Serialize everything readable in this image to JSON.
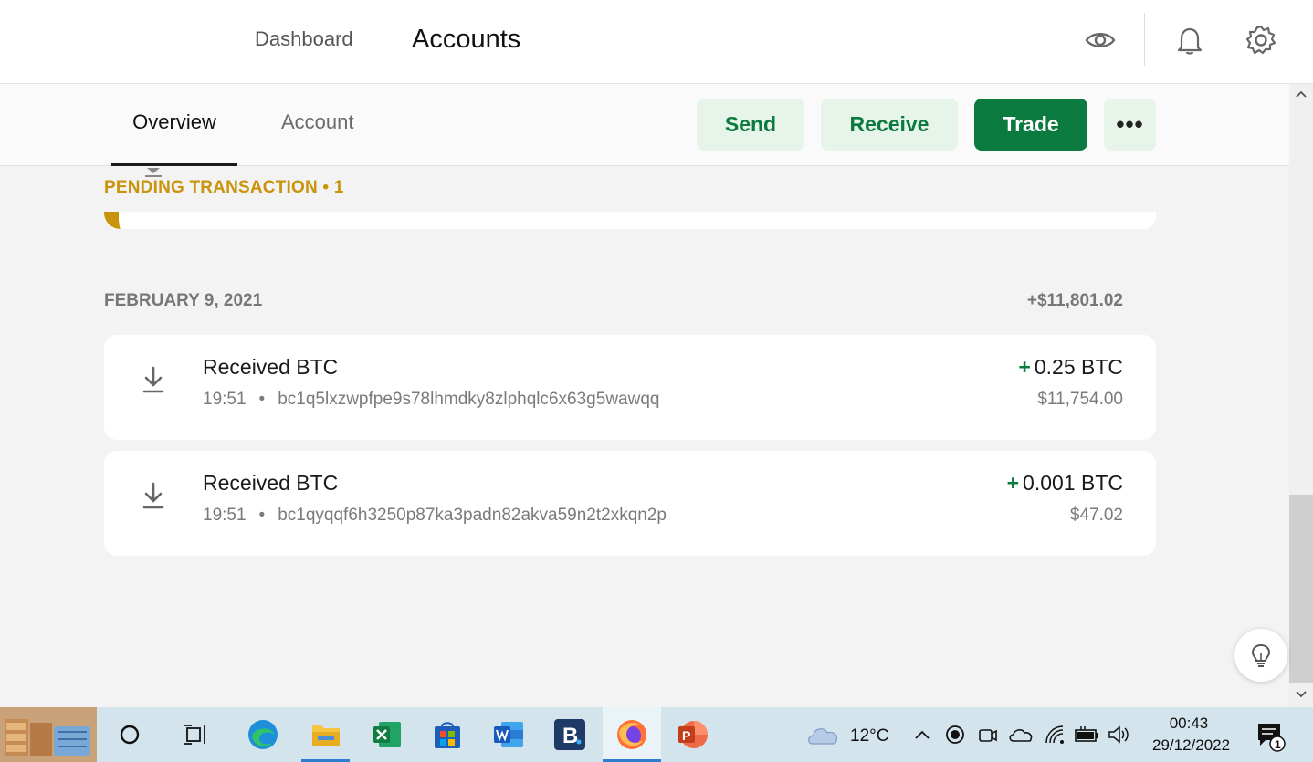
{
  "header": {
    "nav": {
      "dashboard": "Dashboard",
      "accounts": "Accounts"
    },
    "icons": [
      "eye-icon",
      "bell-icon",
      "gear-icon"
    ]
  },
  "subheader": {
    "tabs": {
      "overview": "Overview",
      "account": "Account"
    },
    "actions": {
      "send": "Send",
      "receive": "Receive",
      "trade": "Trade",
      "more": "•••"
    }
  },
  "pending": {
    "label": "PENDING TRANSACTION • 1"
  },
  "group": {
    "date": "FEBRUARY 9, 2021",
    "total": "+$11,801.02",
    "transactions": [
      {
        "title": "Received BTC",
        "time": "19:51",
        "address": "bc1q5lxzwpfpe9s78lhmdky8zlphqlc6x63g5wawqq",
        "sign": "+",
        "amount": "0.25 BTC",
        "fiat": "$11,754.00"
      },
      {
        "title": "Received BTC",
        "time": "19:51",
        "address": "bc1qyqqf6h3250p87ka3padn82akva59n2t2xkqn2p",
        "sign": "+",
        "amount": "0.001 BTC",
        "fiat": "$47.02"
      }
    ]
  },
  "taskbar": {
    "weather": "12°C",
    "time": "00:43",
    "date": "29/12/2022",
    "notification_count": "1"
  },
  "colors": {
    "accent_green": "#0b7a3e",
    "pending_gold": "#c9930a"
  }
}
